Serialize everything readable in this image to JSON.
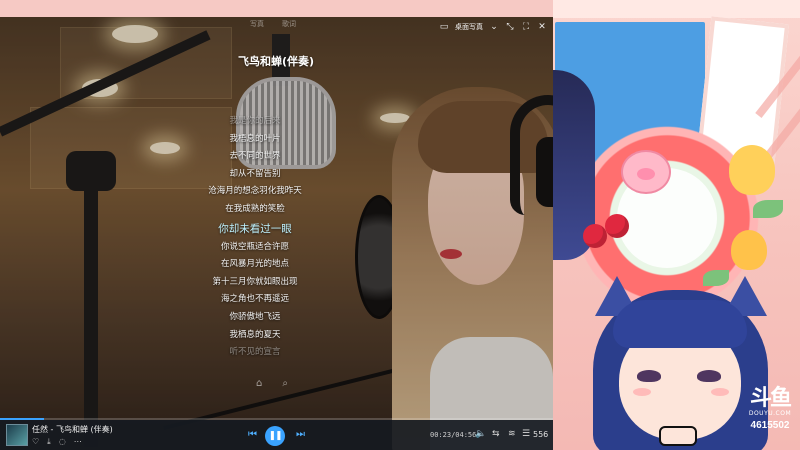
{
  "window": {
    "top_tabs": [
      "写真",
      "歌词"
    ],
    "desktop_lyrics_label": "桌面写真",
    "icons": [
      "desktop-lyrics-icon",
      "chevron-down-icon",
      "shrink-icon",
      "fullscreen-icon",
      "close-icon"
    ]
  },
  "lyrics": {
    "song_title": "飞鸟和蝉(伴奏)",
    "lines": [
      "我是你的后来",
      "我梧息的叶片",
      "去不同的世界",
      "却从不留告别",
      "沧海月的想念羽化我昨天",
      "在我成熟的笑脸",
      "你却未看过一眼",
      "你说空瓶适合许愿",
      "在风暴月光的地点",
      "第十三月你就如眼出现",
      "海之角也不再遥远",
      "你骄傲地飞远",
      "我栖息的夏天",
      "听不见的宣言"
    ],
    "active_index": 6
  },
  "player": {
    "now_playing": "任然 - 飞鸟和蝉 (伴奏)",
    "time": "00:23/04:56",
    "progress": 0.08,
    "queue_count": "556",
    "accent": "#3aa3ff"
  },
  "overlay": {
    "platform_mark": "斗鱼",
    "platform_sub": "DOUYU.COM",
    "room_id": "4615502"
  }
}
